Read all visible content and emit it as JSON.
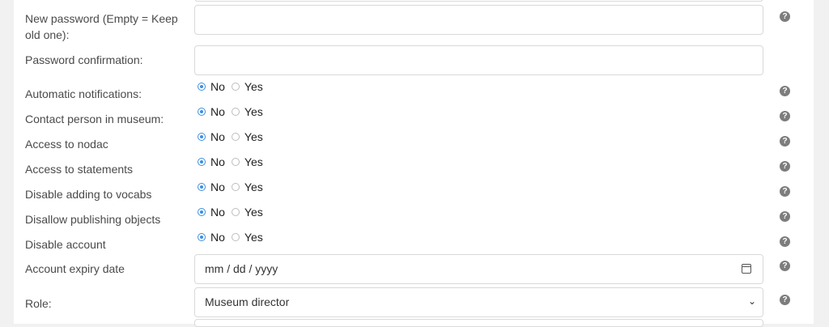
{
  "form": {
    "new_password_label_1": "New password (Empty = Keep",
    "new_password_label_2": "old one):",
    "new_password_value": "",
    "password_confirmation_label": "Password confirmation:",
    "password_confirmation_value": "",
    "automatic_notifications_label": "Automatic notifications:",
    "contact_person_label": "Contact person in museum:",
    "access_nodac_label": "Access to nodac",
    "access_statements_label": "Access to statements",
    "disable_vocabs_label": "Disable adding to vocabs",
    "disallow_publishing_label": "Disallow publishing objects",
    "disable_account_label": "Disable account",
    "expiry_label": "Account expiry date",
    "expiry_placeholder": "mm / dd / yyyy",
    "role_label": "Role:",
    "role_value": "Museum director",
    "radio_no": "No",
    "radio_yes": "Yes",
    "help_glyph": "?"
  },
  "icons": {
    "help": "question-circle-icon",
    "calendar": "calendar-icon",
    "dropdown": "chevron-down-icon"
  },
  "colors": {
    "accent": "#3d8fe0",
    "help_icon": "#7d7d7d",
    "page_bg": "#f1f1f1"
  }
}
